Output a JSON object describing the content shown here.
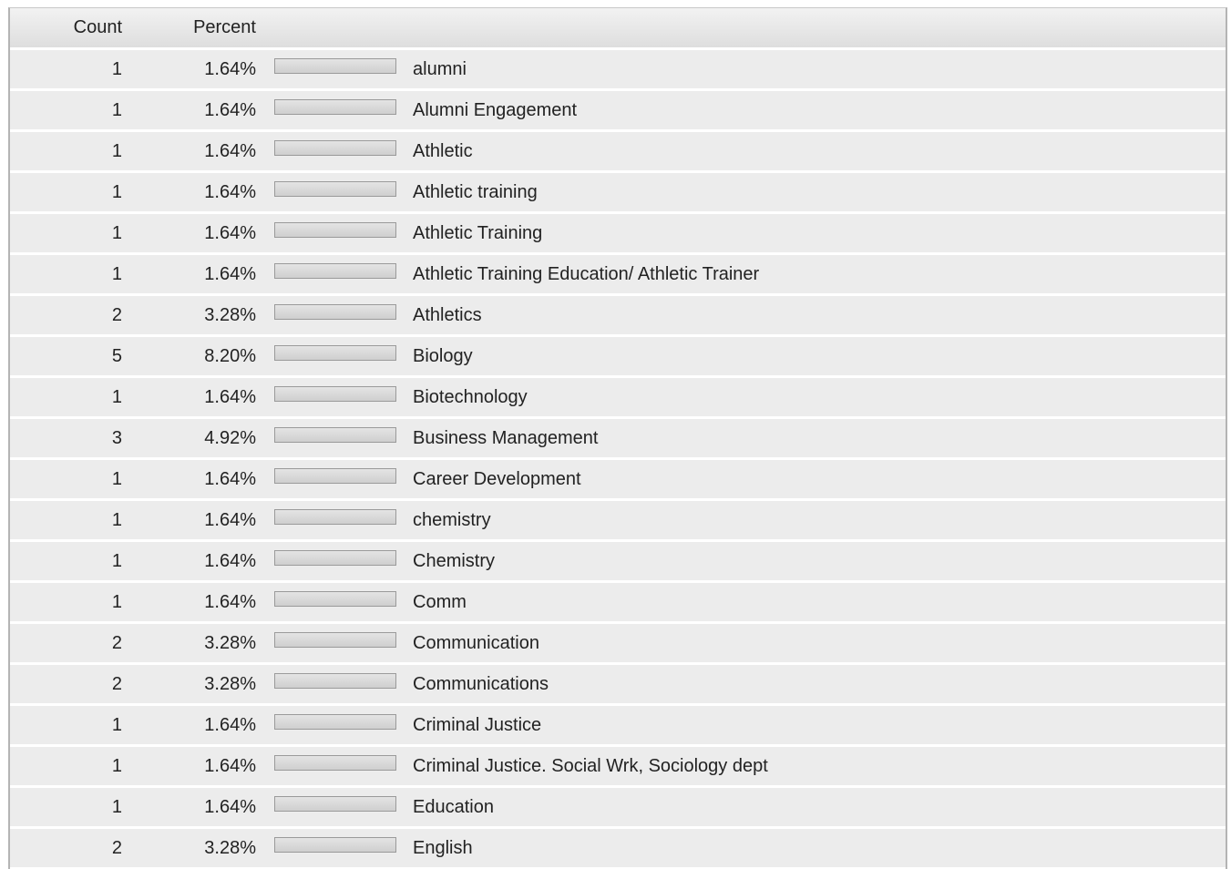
{
  "table": {
    "headers": {
      "count": "Count",
      "percent": "Percent"
    },
    "rows": [
      {
        "count": "1",
        "percent": "1.64%",
        "label": "alumni"
      },
      {
        "count": "1",
        "percent": "1.64%",
        "label": "Alumni Engagement"
      },
      {
        "count": "1",
        "percent": "1.64%",
        "label": "Athletic"
      },
      {
        "count": "1",
        "percent": "1.64%",
        "label": "Athletic training"
      },
      {
        "count": "1",
        "percent": "1.64%",
        "label": "Athletic Training"
      },
      {
        "count": "1",
        "percent": "1.64%",
        "label": "Athletic Training Education/ Athletic Trainer"
      },
      {
        "count": "2",
        "percent": "3.28%",
        "label": "Athletics"
      },
      {
        "count": "5",
        "percent": "8.20%",
        "label": "Biology"
      },
      {
        "count": "1",
        "percent": "1.64%",
        "label": "Biotechnology"
      },
      {
        "count": "3",
        "percent": "4.92%",
        "label": "Business Management"
      },
      {
        "count": "1",
        "percent": "1.64%",
        "label": "Career Development"
      },
      {
        "count": "1",
        "percent": "1.64%",
        "label": "chemistry"
      },
      {
        "count": "1",
        "percent": "1.64%",
        "label": "Chemistry"
      },
      {
        "count": "1",
        "percent": "1.64%",
        "label": "Comm"
      },
      {
        "count": "2",
        "percent": "3.28%",
        "label": "Communication"
      },
      {
        "count": "2",
        "percent": "3.28%",
        "label": "Communications"
      },
      {
        "count": "1",
        "percent": "1.64%",
        "label": "Criminal Justice"
      },
      {
        "count": "1",
        "percent": "1.64%",
        "label": "Criminal Justice. Social Wrk, Sociology dept"
      },
      {
        "count": "1",
        "percent": "1.64%",
        "label": "Education"
      },
      {
        "count": "2",
        "percent": "3.28%",
        "label": "English"
      },
      {
        "count": "",
        "percent": "",
        "label": ""
      }
    ]
  },
  "colors": {
    "row_background": "#ececec",
    "header_background": "#e6e6e6",
    "bar_border": "#9a9a9a"
  }
}
